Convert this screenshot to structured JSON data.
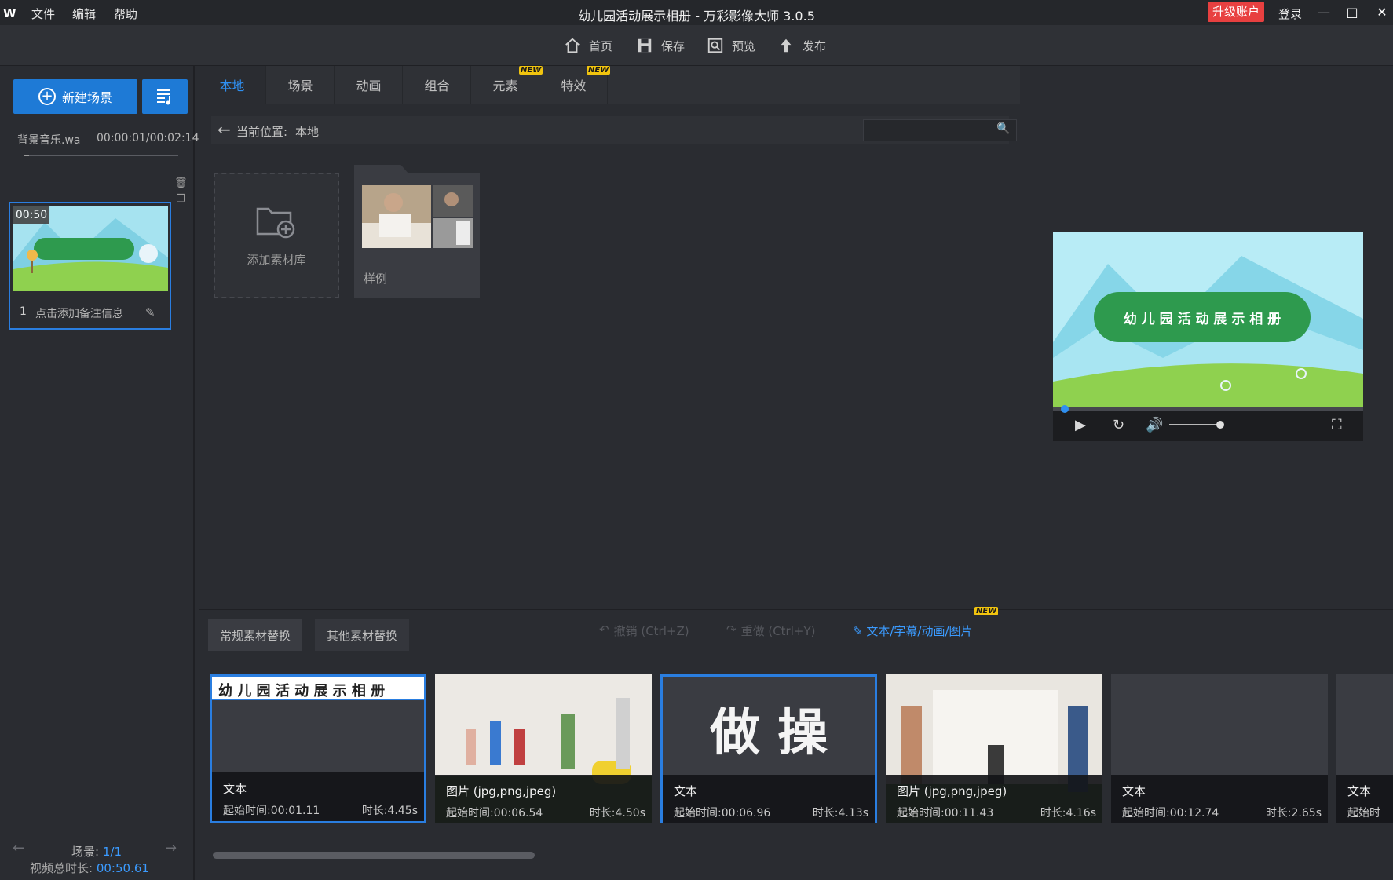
{
  "titlebar": {
    "logo": "W",
    "menu": [
      "文件",
      "编辑",
      "帮助"
    ],
    "title": "幼儿园活动展示相册 - 万彩影像大师 3.0.5",
    "upgrade": "升级账户",
    "login": "登录",
    "window_controls": [
      "minimize-icon",
      "maximize-icon",
      "close-icon"
    ]
  },
  "toolbar": {
    "home": "首页",
    "save": "保存",
    "preview": "预览",
    "publish": "发布"
  },
  "left": {
    "new_scene": "新建场景",
    "music": {
      "name": "背景音乐.wa",
      "time": "00:00:01/00:02:14"
    },
    "scene_card": {
      "duration": "00:50",
      "number": "1",
      "note": "点击添加备注信息"
    },
    "footer": {
      "scene_label": "场景:",
      "scene_value": "1/1",
      "total_label": "视频总时长:",
      "total_value": "00:50.61"
    }
  },
  "center": {
    "tabs": [
      {
        "label": "本地",
        "active": true,
        "new": false
      },
      {
        "label": "场景",
        "active": false,
        "new": false
      },
      {
        "label": "动画",
        "active": false,
        "new": false
      },
      {
        "label": "组合",
        "active": false,
        "new": false
      },
      {
        "label": "元素",
        "active": false,
        "new": true
      },
      {
        "label": "特效",
        "active": false,
        "new": true
      }
    ],
    "new_badge": "NEW",
    "path_label": "当前位置:",
    "path_value": "本地",
    "search_placeholder": "",
    "add_library": "添加素材库",
    "sample_folder": "样例"
  },
  "preview": {
    "banner": "幼 儿 园 活 动 展 示 相 册"
  },
  "bottom": {
    "replace_tabs": [
      "常规素材替换",
      "其他素材替换"
    ],
    "undo": "撤销 (Ctrl+Z)",
    "redo": "重做 (Ctrl+Y)",
    "text_anim": "文本/字幕/动画/图片",
    "new_badge": "NEW",
    "clips": [
      {
        "kind": "文本",
        "start": "起始时间:00:01.11",
        "dur": "时长:4.45s",
        "preview_text": "幼 儿 园 活 动 展 示 相 册",
        "type": "text",
        "selected": true
      },
      {
        "kind": "图片 (jpg,png,jpeg)",
        "start": "起始时间:00:06.54",
        "dur": "时长:4.50s",
        "type": "image",
        "selected": false
      },
      {
        "kind": "文本",
        "start": "起始时间:00:06.96",
        "dur": "时长:4.13s",
        "preview_text": "做 操",
        "type": "text",
        "selected": false
      },
      {
        "kind": "图片 (jpg,png,jpeg)",
        "start": "起始时间:00:11.43",
        "dur": "时长:4.16s",
        "type": "image",
        "selected": false
      },
      {
        "kind": "文本",
        "start": "起始时间:00:12.74",
        "dur": "时长:2.65s",
        "type": "text",
        "selected": false
      },
      {
        "kind": "文本",
        "start": "起始时",
        "dur": "",
        "type": "text",
        "selected": false
      }
    ]
  },
  "colors": {
    "accent": "#1e7ad6",
    "upgrade": "#e84040",
    "link": "#3b9bff",
    "new_badge": "#f1c40f"
  }
}
